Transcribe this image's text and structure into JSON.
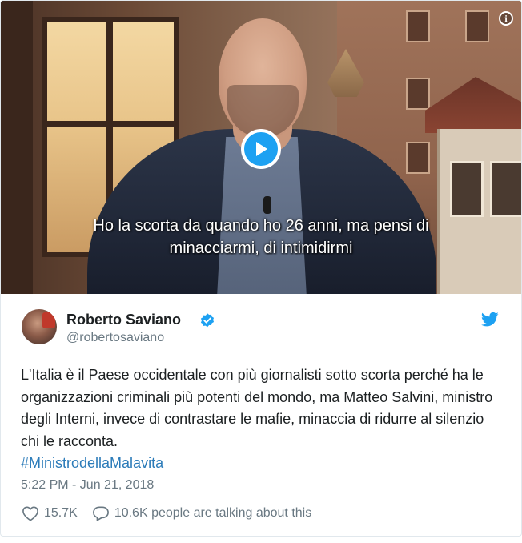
{
  "video": {
    "subtitle_line1": "Ho la scorta da quando ho 26 anni, ma pensi di",
    "subtitle_line2": "minacciarmi, di intimidirmi",
    "play_icon": "play-icon",
    "info_icon": "info-icon",
    "accent_color": "#1da1f2"
  },
  "tweet": {
    "author_name": "Roberto Saviano",
    "author_handle": "@robertosaviano",
    "verified_icon": "verified-badge-icon",
    "brand_icon": "twitter-bird-icon",
    "text": "L'Italia è il Paese occidentale con più giornalisti sotto scorta perché ha le organizzazioni criminali più potenti del mondo, ma Matteo Salvini, ministro degli Interni, invece di contrastare le mafie, minaccia di ridurre al silenzio chi le racconta.",
    "hashtag": "#MinistrodellaMalavita",
    "timestamp": "5:22 PM - Jun 21, 2018",
    "likes": "15.7K",
    "replies": "10.6K people are talking about this",
    "like_icon": "heart-icon",
    "reply_icon": "speech-bubble-icon"
  }
}
